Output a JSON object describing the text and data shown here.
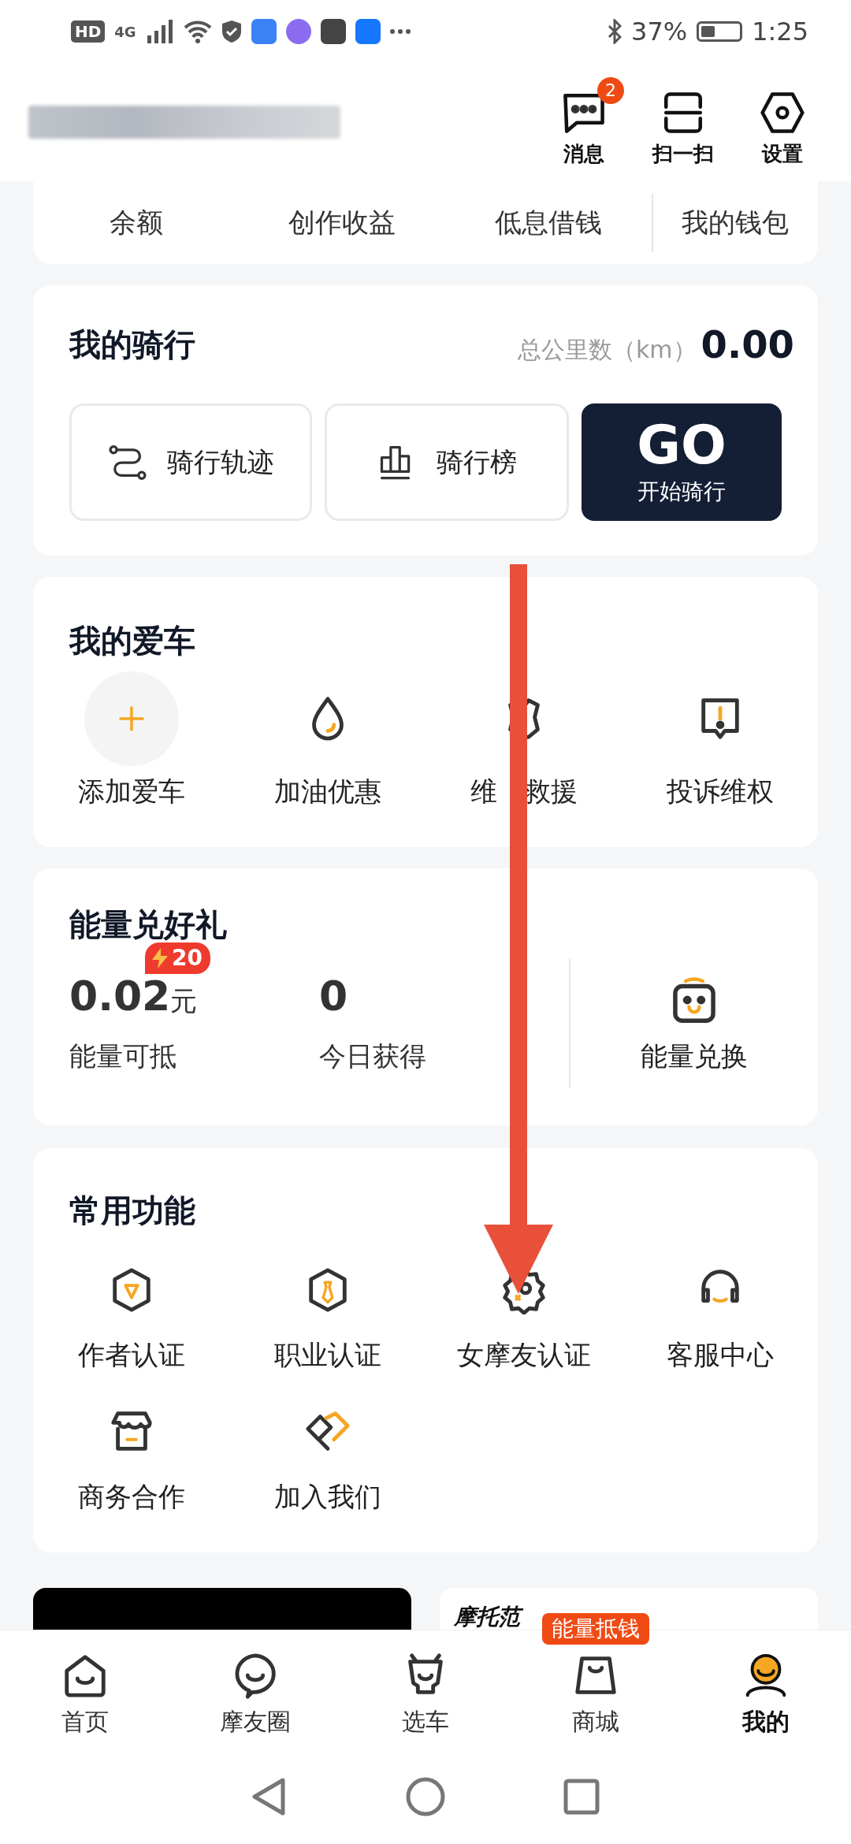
{
  "status_bar": {
    "hd": "HD",
    "network": "4G",
    "battery": "37%",
    "time": "1:25"
  },
  "header": {
    "actions": [
      {
        "label": "消息",
        "kind": "message",
        "badge": "2"
      },
      {
        "label": "扫一扫",
        "kind": "scan"
      },
      {
        "label": "设置",
        "kind": "settings"
      }
    ]
  },
  "wallet": {
    "items": [
      "余额",
      "创作收益",
      "低息借钱",
      "我的钱包"
    ]
  },
  "riding": {
    "title": "我的骑行",
    "distance_label": "总公里数（km）",
    "distance": "0.00",
    "buttons": [
      {
        "label": "骑行轨迹",
        "kind": "track"
      },
      {
        "label": "骑行榜",
        "kind": "rank"
      }
    ],
    "go": {
      "label": "GO",
      "sublabel": "开始骑行"
    }
  },
  "my_car": {
    "title": "我的爱车",
    "items": [
      {
        "label": "添加爱车",
        "kind": "add"
      },
      {
        "label": "加油优惠",
        "kind": "fuel"
      },
      {
        "label_parts": [
          "维",
          "救援"
        ],
        "kind": "repair"
      },
      {
        "label": "投诉维权",
        "kind": "complaint"
      }
    ]
  },
  "energy": {
    "title": "能量兑好礼",
    "stats": [
      {
        "value": "0.02",
        "unit": "元",
        "label": "能量可抵",
        "badge": "20"
      },
      {
        "value": "0",
        "label": "今日获得"
      }
    ],
    "exchange": {
      "label": "能量兑换"
    }
  },
  "functions": {
    "title": "常用功能",
    "items": [
      {
        "label": "作者认证",
        "kind": "author"
      },
      {
        "label": "职业认证",
        "kind": "job"
      },
      {
        "label": "女摩友认证",
        "kind": "female"
      },
      {
        "label": "客服中心",
        "kind": "service"
      },
      {
        "label": "商务合作",
        "kind": "business"
      },
      {
        "label": "加入我们",
        "kind": "join"
      }
    ]
  },
  "banner": {
    "brand": "摩托范"
  },
  "tab_bar": {
    "tabs": [
      {
        "label": "首页",
        "kind": "home",
        "selected": false
      },
      {
        "label": "摩友圈",
        "kind": "circle",
        "selected": false
      },
      {
        "label": "选车",
        "kind": "car",
        "selected": false
      },
      {
        "label": "商城",
        "kind": "mall",
        "selected": false,
        "tag": "能量抵钱"
      },
      {
        "label": "我的",
        "kind": "me",
        "selected": true
      }
    ]
  }
}
